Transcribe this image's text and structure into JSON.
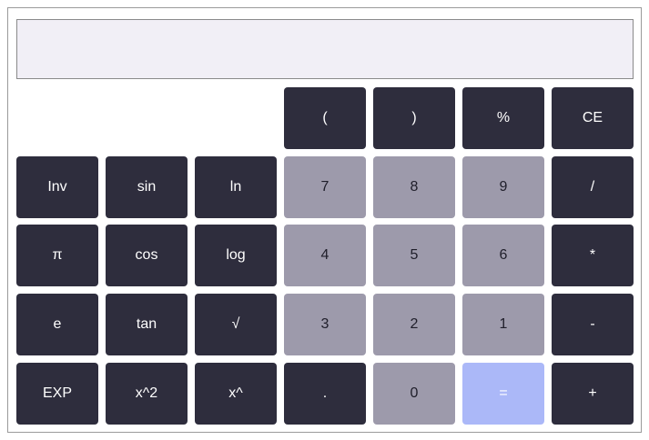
{
  "display": {
    "value": "",
    "placeholder": ""
  },
  "keys": {
    "open_paren": "(",
    "close_paren": ")",
    "percent": "%",
    "clear_entry": "CE",
    "inv": "Inv",
    "sin": "sin",
    "ln": "ln",
    "seven": "7",
    "eight": "8",
    "nine": "9",
    "divide": "/",
    "pi": "π",
    "cos": "cos",
    "log": "log",
    "four": "4",
    "five": "5",
    "six": "6",
    "multiply": "*",
    "e": "e",
    "tan": "tan",
    "sqrt": "√",
    "three": "3",
    "two": "2",
    "one": "1",
    "minus": "-",
    "exp": "EXP",
    "square": "x^2",
    "power": "x^",
    "decimal": ".",
    "zero": "0",
    "equals": "=",
    "plus": "+"
  },
  "colors": {
    "dark_key": "#2e2d3d",
    "digit_key": "#9d9aab",
    "equals_key": "#abb8f8",
    "display_bg": "#f1eff6"
  }
}
